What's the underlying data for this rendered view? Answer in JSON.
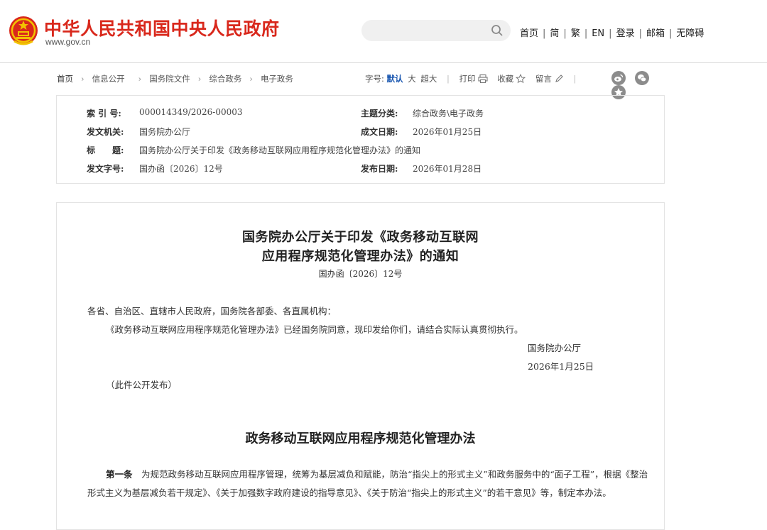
{
  "header": {
    "site_title": "中华人民共和国中央人民政府",
    "site_url": "www.gov.cn",
    "search": {
      "placeholder": ""
    },
    "nav": [
      "首页",
      "简",
      "繁",
      "EN",
      "登录",
      "邮箱",
      "无障碍"
    ]
  },
  "breadcrumb": {
    "items": [
      "首页",
      "信息公开",
      "国务院文件",
      "综合政务",
      "电子政务"
    ]
  },
  "tools": {
    "font_size_label": "字号:",
    "font_sizes": [
      "默认",
      "大",
      "超大"
    ],
    "active_font_size": "默认",
    "print_label": "打印",
    "favorite_label": "收藏",
    "comment_label": "留言"
  },
  "share": {
    "icons": [
      "weibo-icon",
      "wechat-icon",
      "star-icon"
    ]
  },
  "meta": {
    "index_label": "索 引 号:",
    "index_value": "000014349/2026-00003",
    "category_label": "主题分类:",
    "category_value": "综合政务\\电子政务",
    "issuer_label": "发文机关:",
    "issuer_value": "国务院办公厅",
    "written_date_label": "成文日期:",
    "written_date_value": "2026年01月25日",
    "title_label": "标　　题:",
    "title_value": "国务院办公厅关于印发《政务移动互联网应用程序规范化管理办法》的通知",
    "doc_no_label": "发文字号:",
    "doc_no_value": "国办函〔2026〕12号",
    "publish_date_label": "发布日期:",
    "publish_date_value": "2026年01月28日"
  },
  "article": {
    "title_line1": "国务院办公厅关于印发《政务移动互联网",
    "title_line2": "应用程序规范化管理办法》的通知",
    "doc_number": "国办函〔2026〕12号",
    "salutation": "各省、自治区、直辖市人民政府，国务院各部委、各直属机构：",
    "body": "《政务移动互联网应用程序规范化管理办法》已经国务院同意，现印发给你们，请结合实际认真贯彻执行。",
    "signature": "国务院办公厅",
    "sign_date": "2026年1月25日",
    "publish_note": "（此件公开发布）",
    "rules_title": "政务移动互联网应用程序规范化管理办法",
    "clause1_label": "第一条",
    "clause1_text": "为规范政务移动互联网应用程序管理，统筹为基层减负和赋能，防治“指尖上的形式主义”和政务服务中的“面子工程”，根据《整治形式主义为基层减负若干规定》、《关于加强数字政府建设的指导意见》、《关于防治“指尖上的形式主义”的若干意见》等，制定本办法。"
  },
  "colors": {
    "brand_red": "#d9281c",
    "active_blue": "#1a57b0",
    "share_gray": "#8c8c8c"
  }
}
